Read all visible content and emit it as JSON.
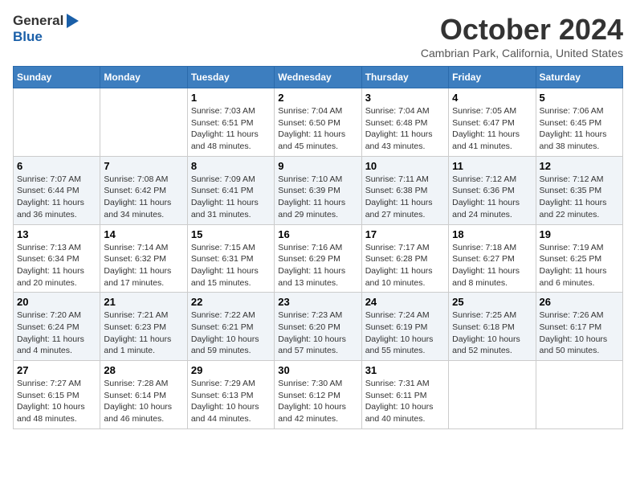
{
  "header": {
    "logo": {
      "general": "General",
      "blue": "Blue",
      "arrow": "▶"
    },
    "month": "October 2024",
    "location": "Cambrian Park, California, United States"
  },
  "days_of_week": [
    "Sunday",
    "Monday",
    "Tuesday",
    "Wednesday",
    "Thursday",
    "Friday",
    "Saturday"
  ],
  "weeks": [
    [
      {
        "day": "",
        "content": ""
      },
      {
        "day": "",
        "content": ""
      },
      {
        "day": "1",
        "content": "Sunrise: 7:03 AM\nSunset: 6:51 PM\nDaylight: 11 hours and 48 minutes."
      },
      {
        "day": "2",
        "content": "Sunrise: 7:04 AM\nSunset: 6:50 PM\nDaylight: 11 hours and 45 minutes."
      },
      {
        "day": "3",
        "content": "Sunrise: 7:04 AM\nSunset: 6:48 PM\nDaylight: 11 hours and 43 minutes."
      },
      {
        "day": "4",
        "content": "Sunrise: 7:05 AM\nSunset: 6:47 PM\nDaylight: 11 hours and 41 minutes."
      },
      {
        "day": "5",
        "content": "Sunrise: 7:06 AM\nSunset: 6:45 PM\nDaylight: 11 hours and 38 minutes."
      }
    ],
    [
      {
        "day": "6",
        "content": "Sunrise: 7:07 AM\nSunset: 6:44 PM\nDaylight: 11 hours and 36 minutes."
      },
      {
        "day": "7",
        "content": "Sunrise: 7:08 AM\nSunset: 6:42 PM\nDaylight: 11 hours and 34 minutes."
      },
      {
        "day": "8",
        "content": "Sunrise: 7:09 AM\nSunset: 6:41 PM\nDaylight: 11 hours and 31 minutes."
      },
      {
        "day": "9",
        "content": "Sunrise: 7:10 AM\nSunset: 6:39 PM\nDaylight: 11 hours and 29 minutes."
      },
      {
        "day": "10",
        "content": "Sunrise: 7:11 AM\nSunset: 6:38 PM\nDaylight: 11 hours and 27 minutes."
      },
      {
        "day": "11",
        "content": "Sunrise: 7:12 AM\nSunset: 6:36 PM\nDaylight: 11 hours and 24 minutes."
      },
      {
        "day": "12",
        "content": "Sunrise: 7:12 AM\nSunset: 6:35 PM\nDaylight: 11 hours and 22 minutes."
      }
    ],
    [
      {
        "day": "13",
        "content": "Sunrise: 7:13 AM\nSunset: 6:34 PM\nDaylight: 11 hours and 20 minutes."
      },
      {
        "day": "14",
        "content": "Sunrise: 7:14 AM\nSunset: 6:32 PM\nDaylight: 11 hours and 17 minutes."
      },
      {
        "day": "15",
        "content": "Sunrise: 7:15 AM\nSunset: 6:31 PM\nDaylight: 11 hours and 15 minutes."
      },
      {
        "day": "16",
        "content": "Sunrise: 7:16 AM\nSunset: 6:29 PM\nDaylight: 11 hours and 13 minutes."
      },
      {
        "day": "17",
        "content": "Sunrise: 7:17 AM\nSunset: 6:28 PM\nDaylight: 11 hours and 10 minutes."
      },
      {
        "day": "18",
        "content": "Sunrise: 7:18 AM\nSunset: 6:27 PM\nDaylight: 11 hours and 8 minutes."
      },
      {
        "day": "19",
        "content": "Sunrise: 7:19 AM\nSunset: 6:25 PM\nDaylight: 11 hours and 6 minutes."
      }
    ],
    [
      {
        "day": "20",
        "content": "Sunrise: 7:20 AM\nSunset: 6:24 PM\nDaylight: 11 hours and 4 minutes."
      },
      {
        "day": "21",
        "content": "Sunrise: 7:21 AM\nSunset: 6:23 PM\nDaylight: 11 hours and 1 minute."
      },
      {
        "day": "22",
        "content": "Sunrise: 7:22 AM\nSunset: 6:21 PM\nDaylight: 10 hours and 59 minutes."
      },
      {
        "day": "23",
        "content": "Sunrise: 7:23 AM\nSunset: 6:20 PM\nDaylight: 10 hours and 57 minutes."
      },
      {
        "day": "24",
        "content": "Sunrise: 7:24 AM\nSunset: 6:19 PM\nDaylight: 10 hours and 55 minutes."
      },
      {
        "day": "25",
        "content": "Sunrise: 7:25 AM\nSunset: 6:18 PM\nDaylight: 10 hours and 52 minutes."
      },
      {
        "day": "26",
        "content": "Sunrise: 7:26 AM\nSunset: 6:17 PM\nDaylight: 10 hours and 50 minutes."
      }
    ],
    [
      {
        "day": "27",
        "content": "Sunrise: 7:27 AM\nSunset: 6:15 PM\nDaylight: 10 hours and 48 minutes."
      },
      {
        "day": "28",
        "content": "Sunrise: 7:28 AM\nSunset: 6:14 PM\nDaylight: 10 hours and 46 minutes."
      },
      {
        "day": "29",
        "content": "Sunrise: 7:29 AM\nSunset: 6:13 PM\nDaylight: 10 hours and 44 minutes."
      },
      {
        "day": "30",
        "content": "Sunrise: 7:30 AM\nSunset: 6:12 PM\nDaylight: 10 hours and 42 minutes."
      },
      {
        "day": "31",
        "content": "Sunrise: 7:31 AM\nSunset: 6:11 PM\nDaylight: 10 hours and 40 minutes."
      },
      {
        "day": "",
        "content": ""
      },
      {
        "day": "",
        "content": ""
      }
    ]
  ]
}
